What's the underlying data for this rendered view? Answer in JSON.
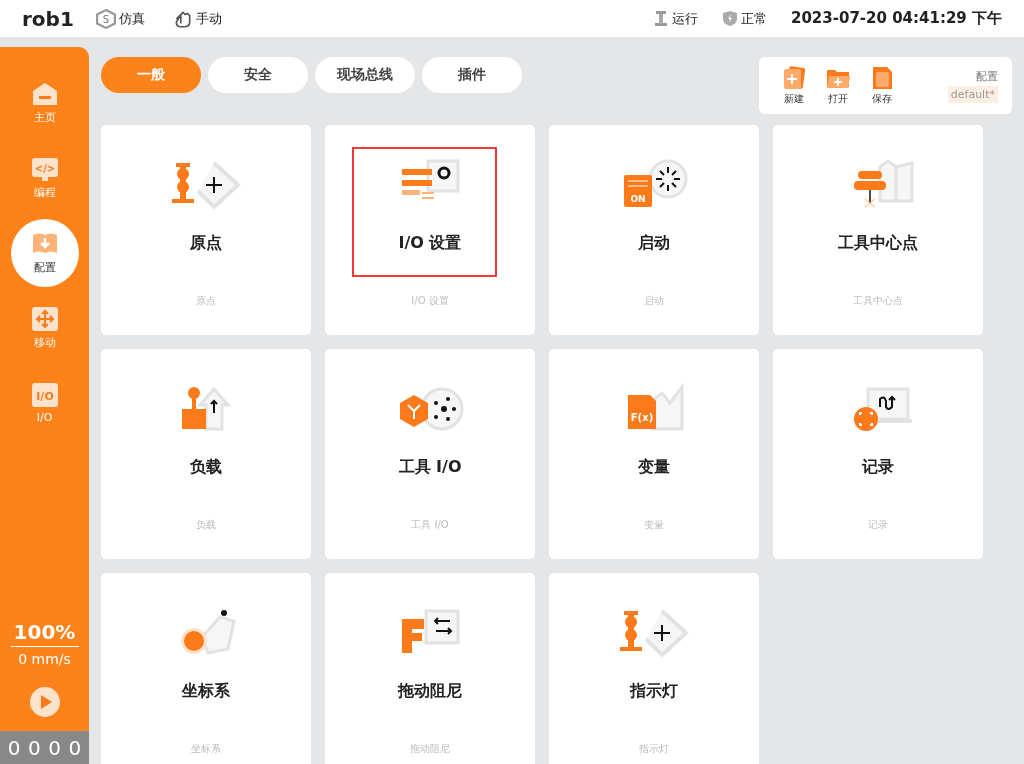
{
  "top_bar": {
    "robot": "rob1",
    "modes": [
      {
        "kind": "sim",
        "icon_text": "S",
        "label": "仿真"
      },
      {
        "kind": "hand",
        "label": "手动"
      }
    ],
    "status": [
      {
        "kind": "robot",
        "label": "运行"
      },
      {
        "kind": "shield",
        "label": "正常"
      }
    ],
    "datetime": "2023-07-20 04:41:29 下午"
  },
  "sidebar": {
    "items": [
      {
        "kind": "home",
        "label": "主页",
        "selected": false
      },
      {
        "kind": "code",
        "icon_text": "</>",
        "label": "编程",
        "selected": false
      },
      {
        "kind": "config",
        "label": "配置",
        "selected": true
      },
      {
        "kind": "move",
        "label": "移动",
        "selected": false
      },
      {
        "kind": "io",
        "icon_text": "I/O",
        "label": "I/O",
        "selected": false
      }
    ],
    "speed": "100%",
    "velocity": "0 mm/s",
    "counter": [
      "0",
      "0",
      "0",
      "0"
    ]
  },
  "tabs": [
    {
      "label": "一般",
      "selected": true
    },
    {
      "label": "安全",
      "selected": false
    },
    {
      "label": "现场总线",
      "selected": false
    },
    {
      "label": "插件",
      "selected": false
    }
  ],
  "file_panel": {
    "buttons": [
      {
        "kind": "new",
        "label": "新建"
      },
      {
        "kind": "open",
        "label": "打开"
      },
      {
        "kind": "save",
        "label": "保存"
      }
    ],
    "config_label": "配置",
    "config_value": "default*"
  },
  "tiles": [
    {
      "kind": "origin",
      "title": "原点",
      "subtitle": "原点",
      "highlighted": false
    },
    {
      "kind": "io",
      "title": "I/O 设置",
      "subtitle": "I/O 设置",
      "highlighted": true
    },
    {
      "kind": "startup",
      "icon_text": "ON",
      "title": "启动",
      "subtitle": "启动",
      "highlighted": false
    },
    {
      "kind": "tcp",
      "title": "工具中心点",
      "subtitle": "工具中心点",
      "highlighted": false
    },
    {
      "kind": "payload",
      "title": "负载",
      "subtitle": "负载",
      "highlighted": false
    },
    {
      "kind": "toolio",
      "title": "工具 I/O",
      "subtitle": "工具 I/O",
      "highlighted": false
    },
    {
      "kind": "variable",
      "icon_text": "F(x)",
      "title": "变量",
      "subtitle": "变量",
      "highlighted": false
    },
    {
      "kind": "log",
      "title": "记录",
      "subtitle": "记录",
      "highlighted": false
    },
    {
      "kind": "frame",
      "title": "坐标系",
      "subtitle": "坐标系",
      "highlighted": false
    },
    {
      "kind": "drag",
      "title": "拖动阻尼",
      "subtitle": "拖动阻尼",
      "highlighted": false
    },
    {
      "kind": "origin",
      "title": "指示灯",
      "subtitle": "指示灯",
      "highlighted": false
    }
  ]
}
